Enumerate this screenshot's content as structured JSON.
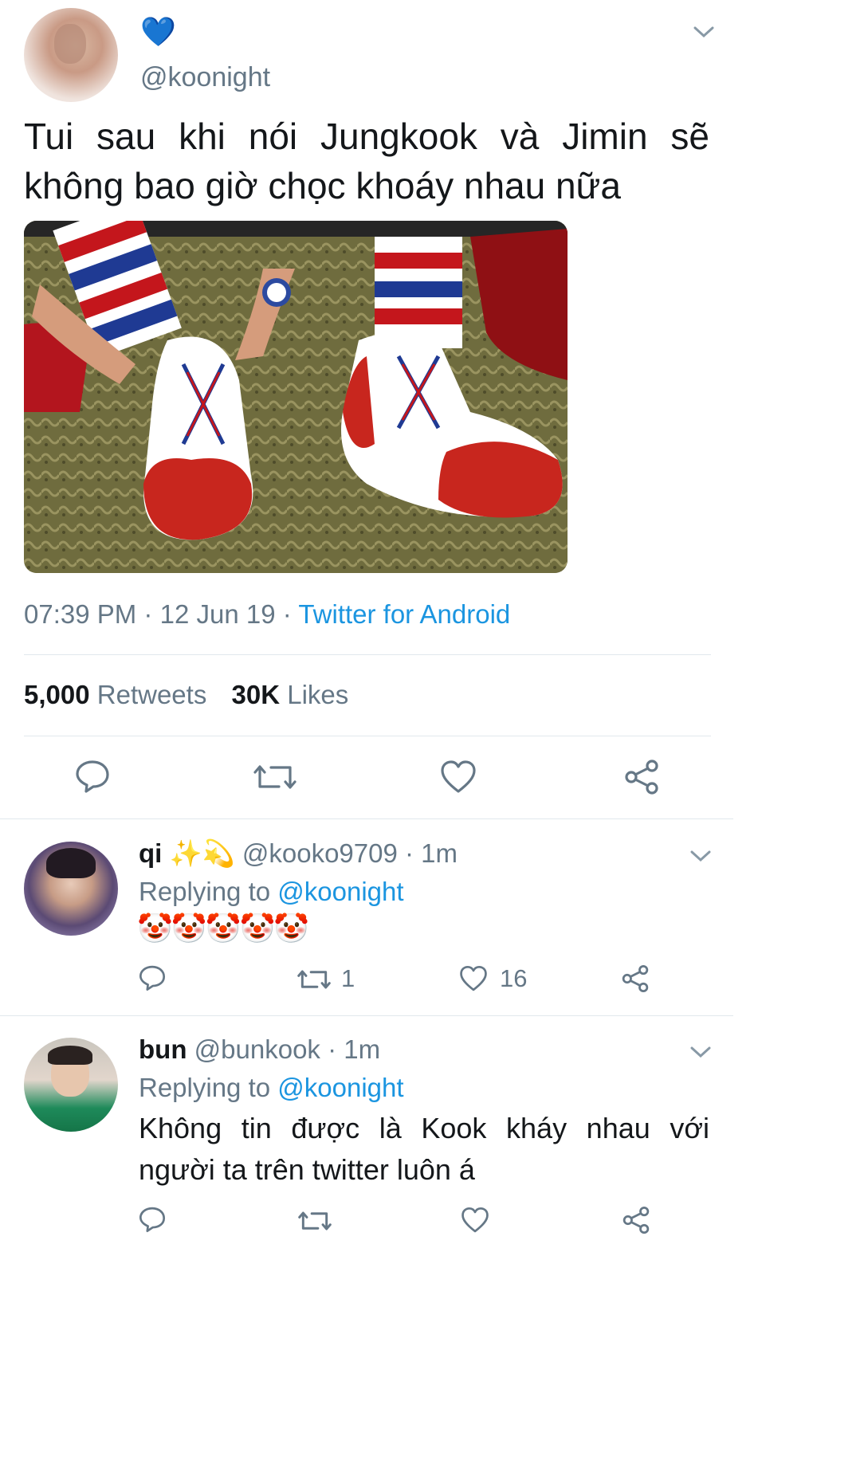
{
  "main_tweet": {
    "badge_emoji": "💙",
    "handle": "@koonight",
    "text_line1": "Tui sau khi nói Jungkook và Jimin sẽ",
    "text_line2": "không bao giờ chọc khoáy nhau nữa",
    "time": "07:39 PM",
    "sep1": "·",
    "date": "12 Jun 19",
    "sep2": "·",
    "source": "Twitter for Android",
    "retweets_count": "5,000",
    "retweets_label": "Retweets",
    "likes_count": "30K",
    "likes_label": "Likes"
  },
  "replies": [
    {
      "name": "qi",
      "name_emoji": "✨💫",
      "handle": "@kooko9709",
      "time": "· 1m",
      "replying_prefix": "Replying to",
      "replying_to": "@koonight",
      "text": "🤡🤡🤡🤡🤡",
      "retweet_count": "1",
      "like_count": "16"
    },
    {
      "name": "bun",
      "handle": "@bunkook",
      "time": "· 1m",
      "replying_prefix": "Replying to",
      "replying_to": "@koonight",
      "text_line1": "Không tin được là Kook kháy nhau với",
      "text_line2": "người ta trên twitter luôn á"
    }
  ],
  "colors": {
    "link": "#1b95e0",
    "secondary": "#657786",
    "divider": "#e1e8ed"
  },
  "icons": [
    "chevron-down-icon",
    "reply-icon",
    "retweet-icon",
    "like-icon",
    "share-icon"
  ]
}
